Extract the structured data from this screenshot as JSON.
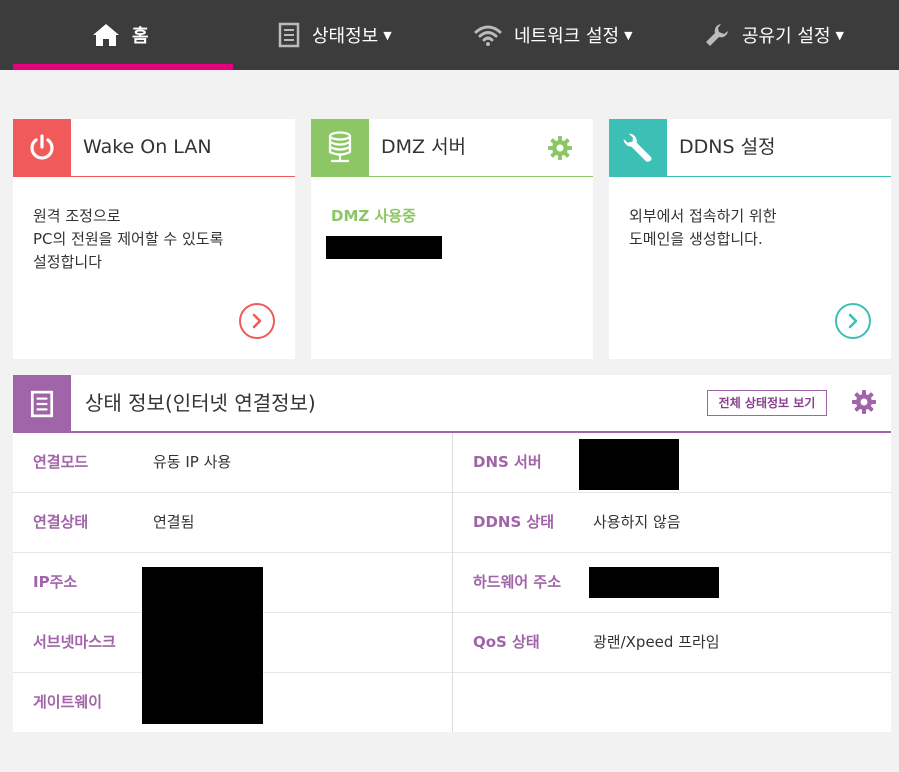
{
  "nav": {
    "home": "홈",
    "status": "상태정보",
    "network": "네트워크 설정",
    "router": "공유기 설정",
    "caret": "▼",
    "accent": "#e6007e"
  },
  "cards": {
    "wol": {
      "title": "Wake On LAN",
      "line1": "원격 조정으로",
      "line2": "PC의 전원을 제어할 수 있도록",
      "line3": "설정합니다",
      "color": "#f15a5a",
      "icon": "power-icon"
    },
    "dmz": {
      "title": "DMZ 서버",
      "status": "DMZ 사용중",
      "color": "#8cc665",
      "icon": "database-icon"
    },
    "ddns": {
      "title": "DDNS 설정",
      "line1": "외부에서 접속하기 위한",
      "line2": "도메인을 생성합니다.",
      "color": "#3cbfb5",
      "icon": "wrench-icon"
    }
  },
  "status": {
    "title": "상태 정보(인터넷 연결정보)",
    "view_all": "전체 상태정보 보기",
    "color": "#a064a8",
    "left": [
      {
        "label": "연결모드",
        "value": "유동 IP 사용"
      },
      {
        "label": "연결상태",
        "value": "연결됨"
      },
      {
        "label": "IP주소",
        "value": ""
      },
      {
        "label": "서브넷마스크",
        "value": ""
      },
      {
        "label": "게이트웨이",
        "value": ""
      }
    ],
    "right": [
      {
        "label": "DNS 서버",
        "value": ""
      },
      {
        "label": "DDNS 상태",
        "value": "사용하지 않음"
      },
      {
        "label": "하드웨어 주소",
        "value": ""
      },
      {
        "label": "QoS 상태",
        "value": "광랜/Xpeed 프라임"
      }
    ]
  }
}
